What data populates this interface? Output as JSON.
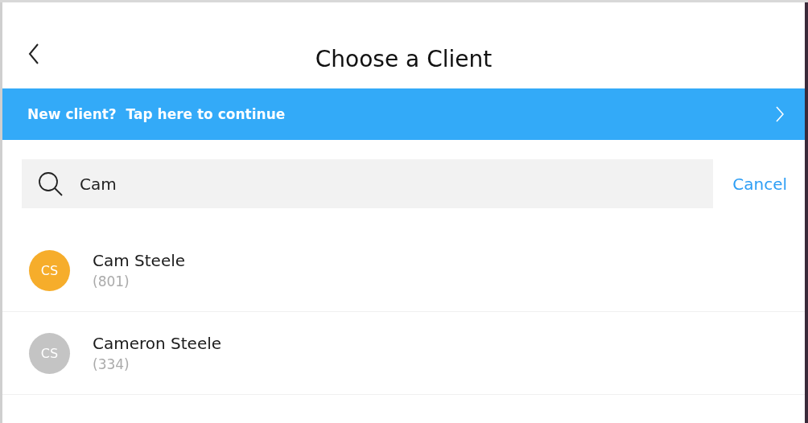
{
  "header": {
    "title": "Choose a Client"
  },
  "banner": {
    "label": "New client?  Tap here to continue"
  },
  "search": {
    "value": "Cam",
    "cancel": "Cancel"
  },
  "clients": [
    {
      "initials": "CS",
      "name": "Cam Steele",
      "phone": "(801)",
      "color": "#f6ad2b"
    },
    {
      "initials": "CS",
      "name": "Cameron Steele",
      "phone": "(334)",
      "color": "#c4c4c4"
    }
  ]
}
